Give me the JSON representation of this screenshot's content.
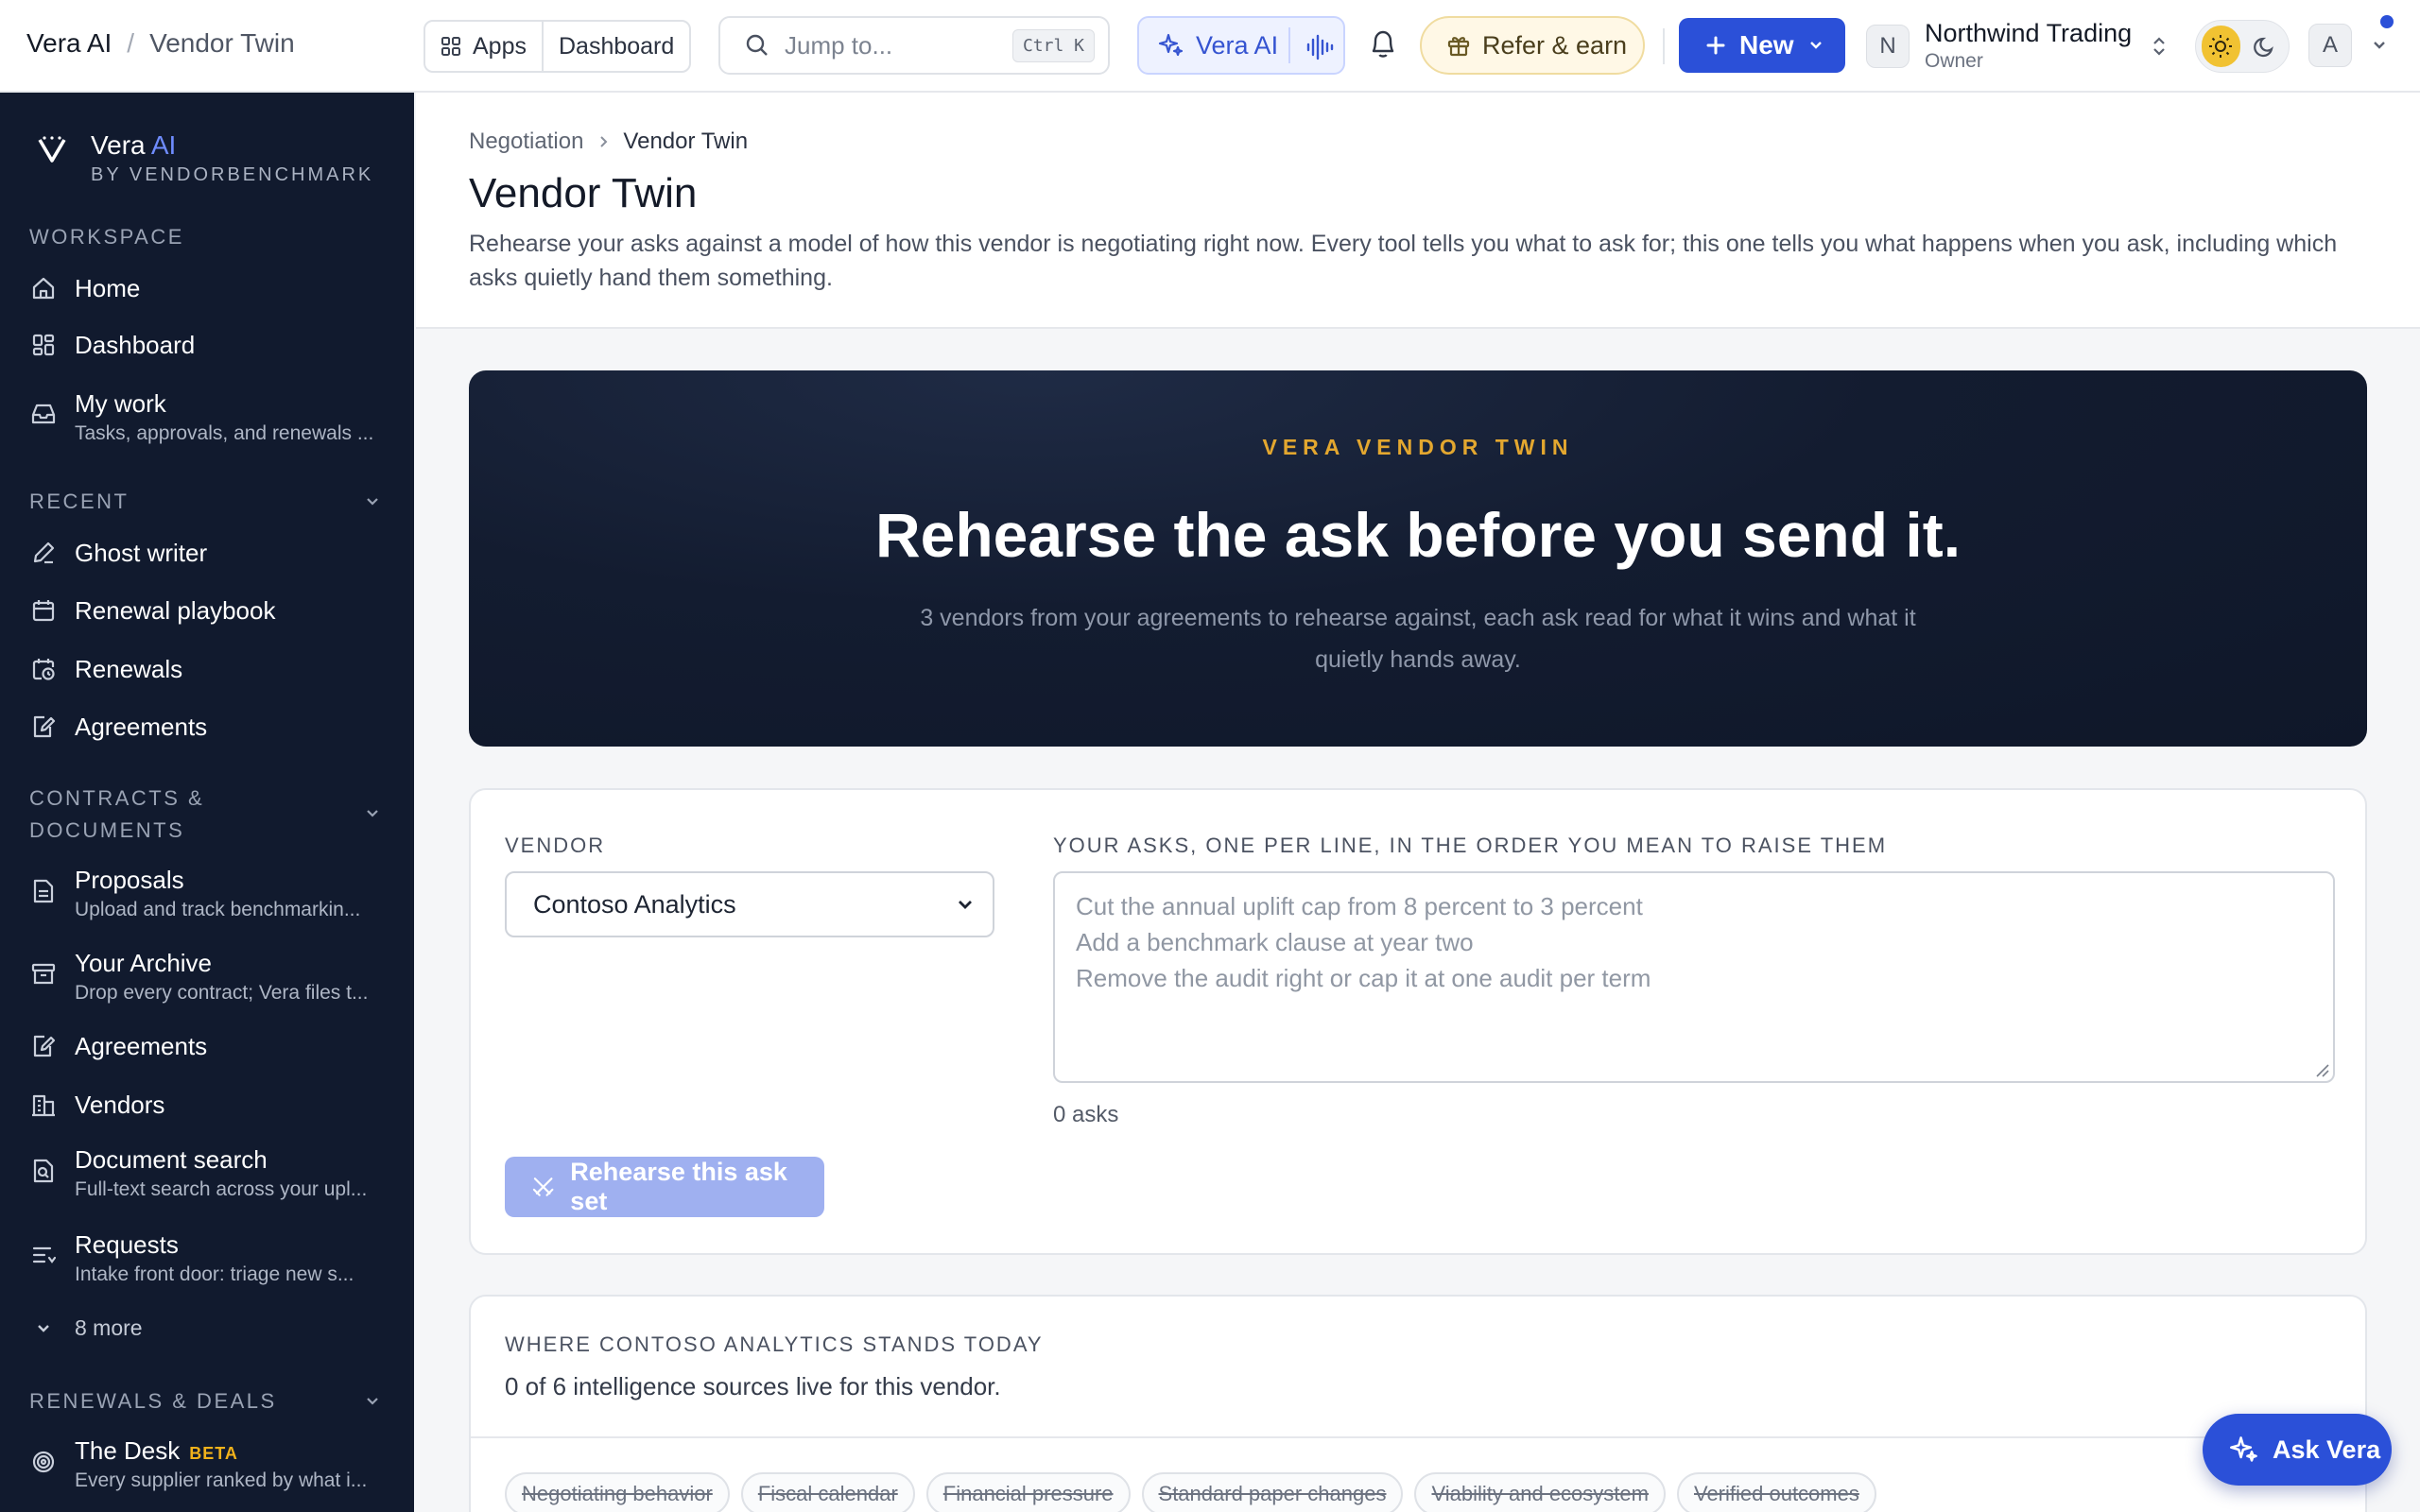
{
  "topbar": {
    "app": "Vera AI",
    "separator": "/",
    "page": "Vendor Twin",
    "apps_label": "Apps",
    "dashboard_label": "Dashboard",
    "search_placeholder": "Jump to...",
    "search_shortcut": "Ctrl K",
    "vera_label": "Vera AI",
    "refer_label": "Refer & earn",
    "new_label": "New",
    "org_initial": "N",
    "org_name": "Northwind Trading",
    "org_role": "Owner",
    "user_initial": "A"
  },
  "sidebar": {
    "brand_name": "Vera",
    "brand_ai": "AI",
    "brand_by": "BY VENDORBENCHMARK",
    "sections": {
      "workspace": "WORKSPACE",
      "recent": "RECENT",
      "contracts": "CONTRACTS &",
      "contracts2": "DOCUMENTS",
      "renewals": "RENEWALS & DEALS"
    },
    "items": {
      "home": "Home",
      "dashboard": "Dashboard",
      "mywork": "My work",
      "mywork_sub": "Tasks, approvals, and renewals ...",
      "ghost": "Ghost writer",
      "playbook": "Renewal playbook",
      "renewals": "Renewals",
      "agreements_recent": "Agreements",
      "proposals": "Proposals",
      "proposals_sub": "Upload and track benchmarkin...",
      "archive": "Your Archive",
      "archive_sub": "Drop every contract; Vera files t...",
      "agreements": "Agreements",
      "vendors": "Vendors",
      "docsearch": "Document search",
      "docsearch_sub": "Full-text search across your upl...",
      "requests": "Requests",
      "requests_sub": "Intake front door: triage new s...",
      "more": "8 more",
      "desk": "The Desk",
      "desk_badge": "BETA",
      "desk_sub": "Every supplier ranked by what i..."
    }
  },
  "page": {
    "breadcrumb_parent": "Negotiation",
    "breadcrumb_current": "Vendor Twin",
    "title": "Vendor Twin",
    "description": "Rehearse your asks against a model of how this vendor is negotiating right now. Every tool tells you what to ask for; this one tells you what happens when you ask, including which asks quietly hand them something."
  },
  "hero": {
    "kicker": "VERA VENDOR TWIN",
    "headline": "Rehearse the ask before you send it.",
    "subtitle": "3 vendors from your agreements to rehearse against, each ask read for what it wins and what it quietly hands away."
  },
  "form": {
    "vendor_label": "VENDOR",
    "vendor_value": "Contoso Analytics",
    "asks_label": "YOUR ASKS, ONE PER LINE, IN THE ORDER YOU MEAN TO RAISE THEM",
    "placeholder_lines": [
      "Cut the annual uplift cap from 8 percent to 3 percent",
      "Add a benchmark clause at year two",
      "Remove the audit right or cap it at one audit per term"
    ],
    "ask_count": "0 asks",
    "submit_label": "Rehearse this ask set"
  },
  "standing": {
    "caption": "WHERE CONTOSO ANALYTICS STANDS TODAY",
    "summary": "0 of 6 intelligence sources live for this vendor.",
    "sources": [
      "Negotiating behavior",
      "Fiscal calendar",
      "Financial pressure",
      "Standard paper changes",
      "Viability and ecosystem",
      "Verified outcomes"
    ]
  },
  "floating": {
    "ask_vera": "Ask Vera"
  },
  "colors": {
    "accent": "#2b50d8",
    "hero_bg": "#131c30",
    "kicker": "#e3a72f",
    "sidebar_bg": "#111a2e"
  }
}
